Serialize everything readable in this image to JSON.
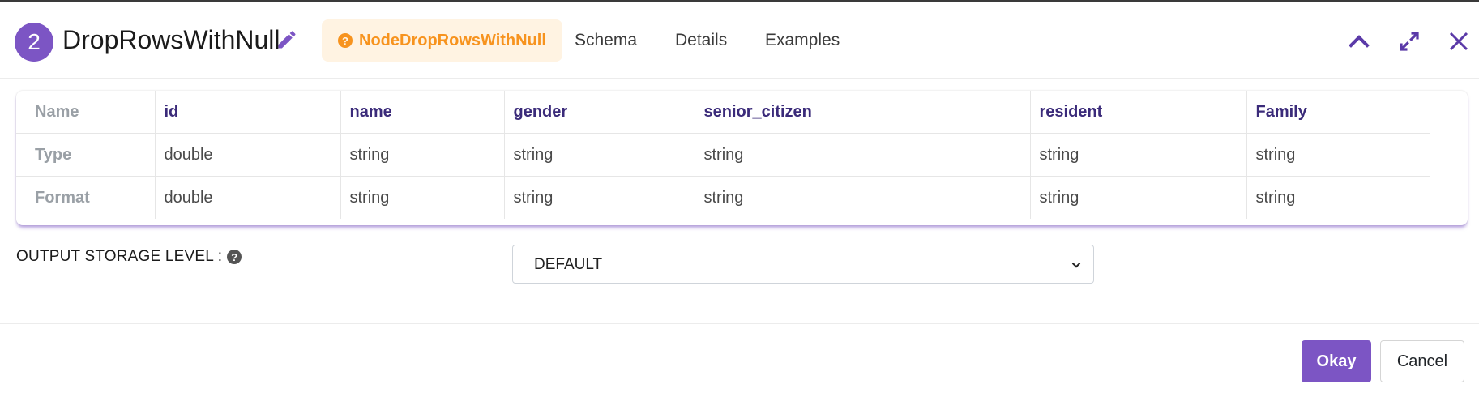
{
  "node": {
    "step_number": "2",
    "title": "DropRowsWithNull",
    "type_pill": "NodeDropRowsWithNull"
  },
  "tabs": [
    {
      "label": "Schema"
    },
    {
      "label": "Details"
    },
    {
      "label": "Examples"
    }
  ],
  "header_icons": [
    "chevron-up-icon",
    "expand-icon",
    "close-icon"
  ],
  "schema": {
    "row_headers": [
      "Name",
      "Type",
      "Format"
    ],
    "columns": [
      {
        "name": "id",
        "type": "double",
        "format": "double"
      },
      {
        "name": "name",
        "type": "string",
        "format": "string"
      },
      {
        "name": "gender",
        "type": "string",
        "format": "string"
      },
      {
        "name": "senior_citizen",
        "type": "string",
        "format": "string"
      },
      {
        "name": "resident",
        "type": "string",
        "format": "string"
      },
      {
        "name": "Family",
        "type": "string",
        "format": "string"
      }
    ]
  },
  "storage": {
    "label": "OUTPUT STORAGE LEVEL :",
    "selected": "DEFAULT"
  },
  "footer": {
    "okay_label": "Okay",
    "cancel_label": "Cancel"
  },
  "colors": {
    "accent": "#7c55c4",
    "pill_text": "#f7931e",
    "pill_bg": "#fff3e2",
    "column_header": "#3b2b7a"
  }
}
